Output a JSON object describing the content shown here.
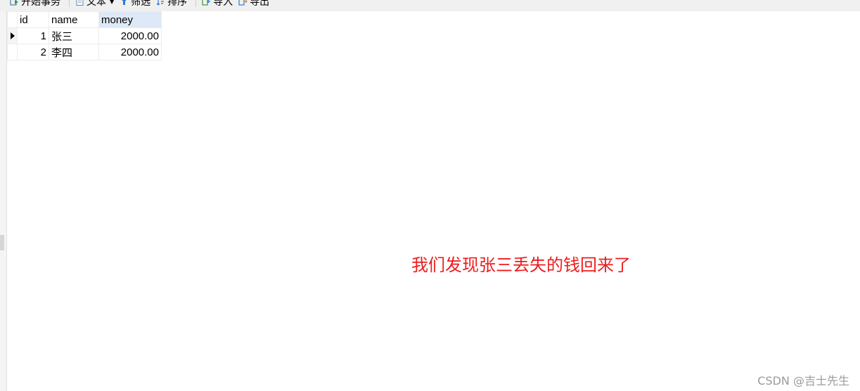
{
  "toolbar": {
    "begin_transaction": "开始事务",
    "text": "文本",
    "filter": "筛选",
    "sort": "排序",
    "import": "导入",
    "export": "导出"
  },
  "table": {
    "columns": [
      "id",
      "name",
      "money"
    ],
    "rows": [
      {
        "id": "1",
        "name": "张三",
        "money": "2000.00"
      },
      {
        "id": "2",
        "name": "李四",
        "money": "2000.00"
      }
    ]
  },
  "annotation": "我们发现张三丢失的钱回来了",
  "watermark": "CSDN @吉士先生",
  "colors": {
    "annotation": "#ee1c1c",
    "header_active": "#dde9f7"
  }
}
